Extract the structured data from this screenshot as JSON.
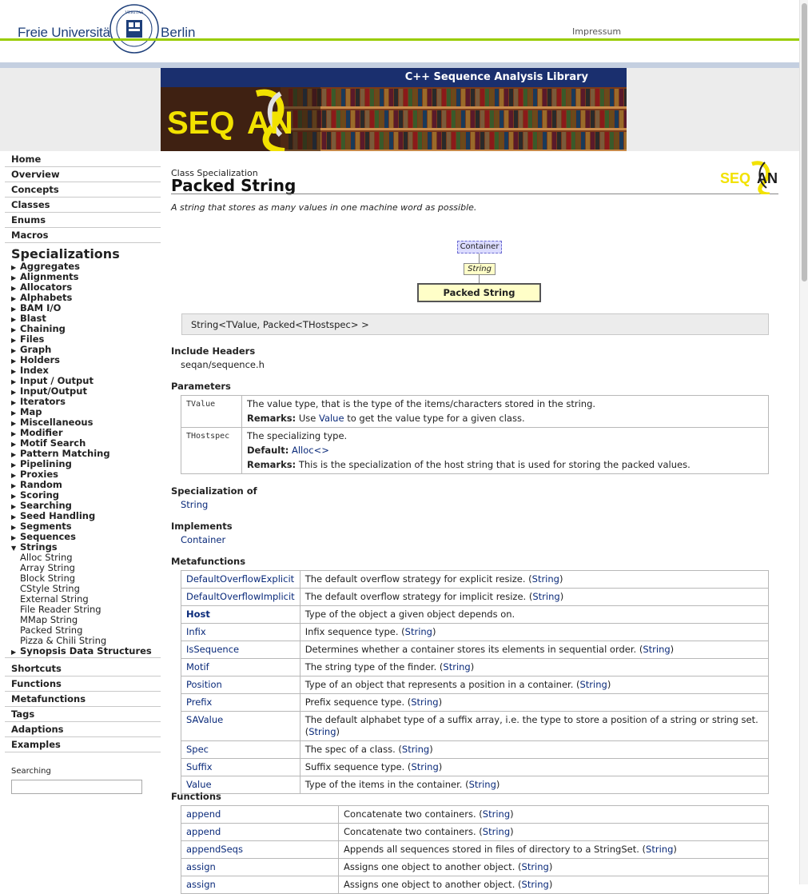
{
  "header": {
    "fu_name_left": "Freie Universität",
    "fu_name_right": "Berlin",
    "impressum": "Impressum"
  },
  "banner": {
    "title": "C++ Sequence Analysis Library"
  },
  "sidebar": {
    "top_items": [
      "Home",
      "Overview",
      "Concepts",
      "Classes",
      "Enums",
      "Macros"
    ],
    "section_title": "Specializations",
    "categories": [
      "Aggregates",
      "Alignments",
      "Allocators",
      "Alphabets",
      "BAM I/O",
      "Blast",
      "Chaining",
      "Files",
      "Graph",
      "Holders",
      "Index",
      "Input / Output",
      "Input/Output",
      "Iterators",
      "Map",
      "Miscellaneous",
      "Modifier",
      "Motif Search",
      "Pattern Matching",
      "Pipelining",
      "Proxies",
      "Random",
      "Scoring",
      "Searching",
      "Seed Handling",
      "Segments",
      "Sequences"
    ],
    "open_category": "Strings",
    "strings_children": [
      "Alloc String",
      "Array String",
      "Block String",
      "CStyle String",
      "External String",
      "File Reader String",
      "MMap String",
      "Packed String",
      "Pizza & Chili String"
    ],
    "after_category": "Synopsis Data Structures",
    "bottom_items": [
      "Shortcuts",
      "Functions",
      "Metafunctions",
      "Tags",
      "Adaptions",
      "Examples"
    ],
    "search_label": "Searching"
  },
  "content": {
    "kind": "Class Specialization",
    "title": "Packed String",
    "tagline": "A string that stores as many values in one machine word as possible.",
    "diagram": {
      "container": "Container",
      "string": "String",
      "current": "Packed String"
    },
    "signature": "String<TValue, Packed<THostspec> >",
    "include_headers_label": "Include Headers",
    "include_header": "seqan/sequence.h",
    "parameters_label": "Parameters",
    "params": [
      {
        "name": "TValue",
        "desc": "The value type, that is the type of the items/characters stored in the string.",
        "remarks_label": "Remarks:",
        "remarks_pre": "Use",
        "remarks_link": "Value",
        "remarks_post": "to get the value type for a given class."
      },
      {
        "name": "THostspec",
        "desc": "The specializing type.",
        "default_label": "Default:",
        "default_link": "Alloc<>",
        "remarks_label": "Remarks:",
        "remarks_text": "This is the specialization of the host string that is used for storing the packed values."
      }
    ],
    "specialization_of_label": "Specialization of",
    "specialization_of": "String",
    "implements_label": "Implements",
    "implements": "Container",
    "metafunctions_label": "Metafunctions",
    "metafunctions": [
      {
        "name": "DefaultOverflowExplicit",
        "desc": "The default overflow strategy for explicit resize.",
        "ref": "String"
      },
      {
        "name": "DefaultOverflowImplicit",
        "desc": "The default overflow strategy for implicit resize.",
        "ref": "String"
      },
      {
        "name": "Host",
        "desc": "Type of the object a given object depends on.",
        "ref": ""
      },
      {
        "name": "Infix",
        "desc": "Infix sequence type.",
        "ref": "String"
      },
      {
        "name": "IsSequence",
        "desc": "Determines whether a container stores its elements in sequential order.",
        "ref": "String"
      },
      {
        "name": "Motif",
        "desc": "The string type of the finder.",
        "ref": "String"
      },
      {
        "name": "Position",
        "desc": "Type of an object that represents a position in a container.",
        "ref": "String"
      },
      {
        "name": "Prefix",
        "desc": "Prefix sequence type.",
        "ref": "String"
      },
      {
        "name": "SAValue",
        "desc": "The default alphabet type of a suffix array, i.e. the type to store a position of a string or string set.",
        "ref": "String"
      },
      {
        "name": "Spec",
        "desc": "The spec of a class.",
        "ref": "String"
      },
      {
        "name": "Suffix",
        "desc": "Suffix sequence type.",
        "ref": "String"
      },
      {
        "name": "Value",
        "desc": "Type of the items in the container.",
        "ref": "String"
      }
    ],
    "functions_label": "Functions",
    "functions": [
      {
        "name": "append",
        "desc": "Concatenate two containers.",
        "ref": "String"
      },
      {
        "name": "append",
        "desc": "Concatenate two containers.",
        "ref": "String"
      },
      {
        "name": "appendSeqs",
        "desc": "Appends all sequences stored in files of directory to a StringSet.",
        "ref": "String"
      },
      {
        "name": "assign",
        "desc": "Assigns one object to another object.",
        "ref": "String"
      },
      {
        "name": "assign",
        "desc": "Assigns one object to another object.",
        "ref": "String"
      }
    ]
  }
}
